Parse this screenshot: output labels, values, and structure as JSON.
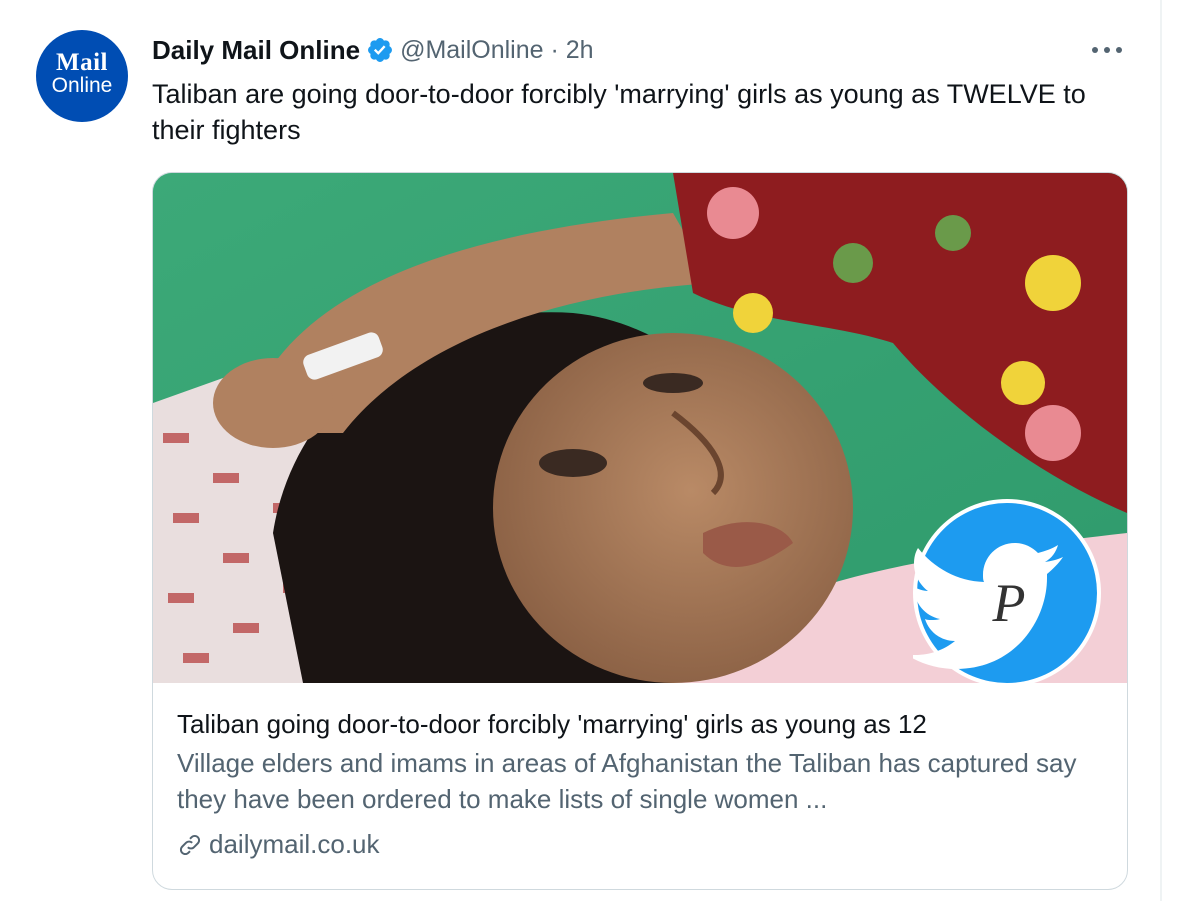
{
  "tweet": {
    "avatar": {
      "line1": "Mail",
      "line2": "Online",
      "color": "#004db3"
    },
    "display_name": "Daily Mail Online",
    "verified_icon": "verified-badge-icon",
    "handle_time": "@MailOnline · 2h",
    "more_icon": "more-options-icon",
    "text": "Taliban are going door-to-door forcibly 'marrying' girls as young as TWELVE to their fighters"
  },
  "card": {
    "image_icon": "photo",
    "watermark_icon": "twitter-bird-watermark-icon",
    "title": "Taliban going door-to-door forcibly 'marrying' girls as young as 12",
    "description": "Village elders and imams in areas of Afghanistan the Taliban has captured say they have been ordered to make lists of single women ...",
    "link_icon": "link-icon",
    "domain": "dailymail.co.uk"
  },
  "colors": {
    "verified": "#1d9bf0",
    "secondary_text": "#536471",
    "border": "#cfd9de"
  }
}
